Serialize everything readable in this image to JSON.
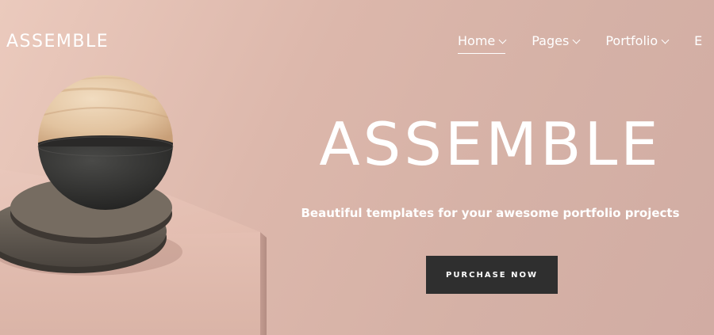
{
  "brand": {
    "name": "ASSEMBLE"
  },
  "nav": {
    "items": [
      {
        "label": "Home",
        "active": true
      },
      {
        "label": "Pages"
      },
      {
        "label": "Portfolio"
      },
      {
        "label": "E"
      }
    ]
  },
  "hero": {
    "title": "ASSEMBLE",
    "subtitle": "Beautiful templates for your awesome portfolio projects",
    "cta_label": "PURCHASE NOW"
  },
  "colors": {
    "background": "#dcb7ab",
    "text": "#ffffff",
    "button": "#2f2f2f"
  }
}
